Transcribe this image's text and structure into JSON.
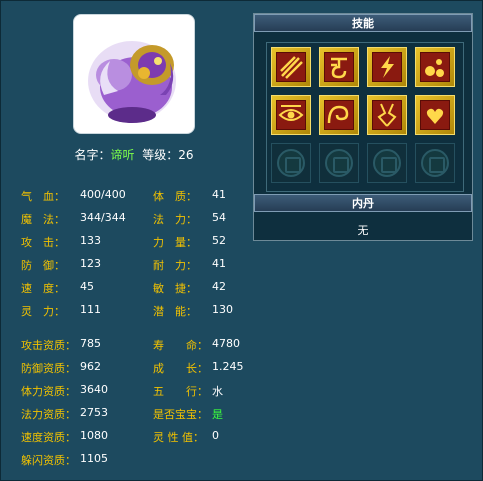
{
  "pet": {
    "name_label": "名字：",
    "name": "谛听",
    "level_label": "等级：",
    "level": "26"
  },
  "stats_left": [
    {
      "label": "气　血：",
      "value": "400/400"
    },
    {
      "label": "魔　法：",
      "value": "344/344"
    },
    {
      "label": "攻　击：",
      "value": "133"
    },
    {
      "label": "防　御：",
      "value": "123"
    },
    {
      "label": "速　度：",
      "value": "45"
    },
    {
      "label": "灵　力：",
      "value": "111"
    }
  ],
  "stats_right": [
    {
      "label": "体　质：",
      "value": "41"
    },
    {
      "label": "法　力：",
      "value": "54"
    },
    {
      "label": "力　量：",
      "value": "52"
    },
    {
      "label": "耐　力：",
      "value": "41"
    },
    {
      "label": "敏　捷：",
      "value": "42"
    },
    {
      "label": "潜　能：",
      "value": "130"
    }
  ],
  "aptitude_left": [
    {
      "label": "攻击资质：",
      "value": "785"
    },
    {
      "label": "防御资质：",
      "value": "962"
    },
    {
      "label": "体力资质：",
      "value": "3640"
    },
    {
      "label": "法力资质：",
      "value": "2753"
    },
    {
      "label": "速度资质：",
      "value": "1080"
    },
    {
      "label": "躲闪资质：",
      "value": "1105"
    }
  ],
  "aptitude_right": [
    {
      "label": "寿　　命：",
      "value": "4780"
    },
    {
      "label": "成　　长：",
      "value": "1.245"
    },
    {
      "label": "五　　行：",
      "value": "水"
    },
    {
      "label": "是否宝宝：",
      "value": "是"
    },
    {
      "label": "灵 性 值：",
      "value": "0"
    }
  ],
  "skills_panel": {
    "title": "技能",
    "skills": [
      {
        "icon": "claw-strike-icon"
      },
      {
        "icon": "rune-scroll-icon"
      },
      {
        "icon": "lightning-icon"
      },
      {
        "icon": "orbs-icon"
      },
      {
        "icon": "eye-symbol-icon"
      },
      {
        "icon": "wave-spiral-icon"
      },
      {
        "icon": "blood-crack-icon"
      },
      {
        "icon": "heart-wings-icon"
      },
      {
        "icon": "empty-slot-icon"
      },
      {
        "icon": "empty-slot-icon"
      },
      {
        "icon": "empty-slot-icon"
      },
      {
        "icon": "empty-slot-icon"
      }
    ]
  },
  "neidan_panel": {
    "title": "内丹",
    "value": "无"
  },
  "colors": {
    "label": "#f2c200",
    "highlight": "#7dff4a",
    "background": "#1d4a5f"
  }
}
